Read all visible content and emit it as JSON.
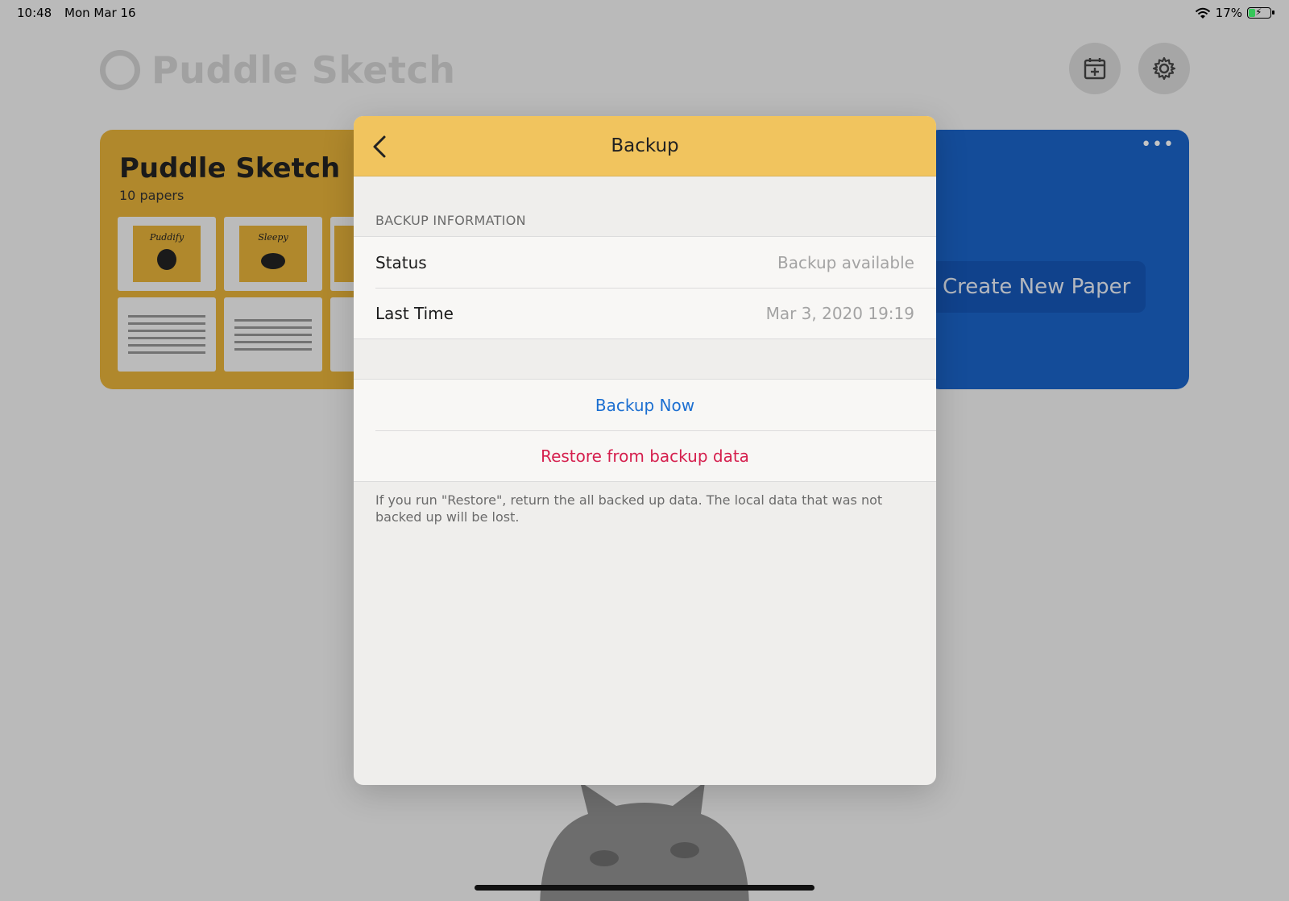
{
  "status_bar": {
    "time": "10:48",
    "date": "Mon Mar 16",
    "battery": "17%"
  },
  "app": {
    "title": "Puddle Sketch",
    "notebook": {
      "title": "Puddle Sketch",
      "count": "10 papers",
      "thumbnails": [
        "Puddify",
        "Sleepy"
      ]
    },
    "create_label": "Create New Paper",
    "more_label": "•••"
  },
  "modal": {
    "title": "Backup",
    "section_header": "BACKUP INFORMATION",
    "info_rows": [
      {
        "label": "Status",
        "value": "Backup available"
      },
      {
        "label": "Last Time",
        "value": "Mar 3, 2020 19:19"
      }
    ],
    "actions": {
      "backup_now": "Backup Now",
      "restore": "Restore from backup data"
    },
    "footer": "If you run \"Restore\", return the all backed up data. The local data that was not backed up will be lost.",
    "colors": {
      "header": "#f1c45e",
      "action_blue": "#1c6fd1",
      "action_red": "#d51f4d"
    }
  }
}
